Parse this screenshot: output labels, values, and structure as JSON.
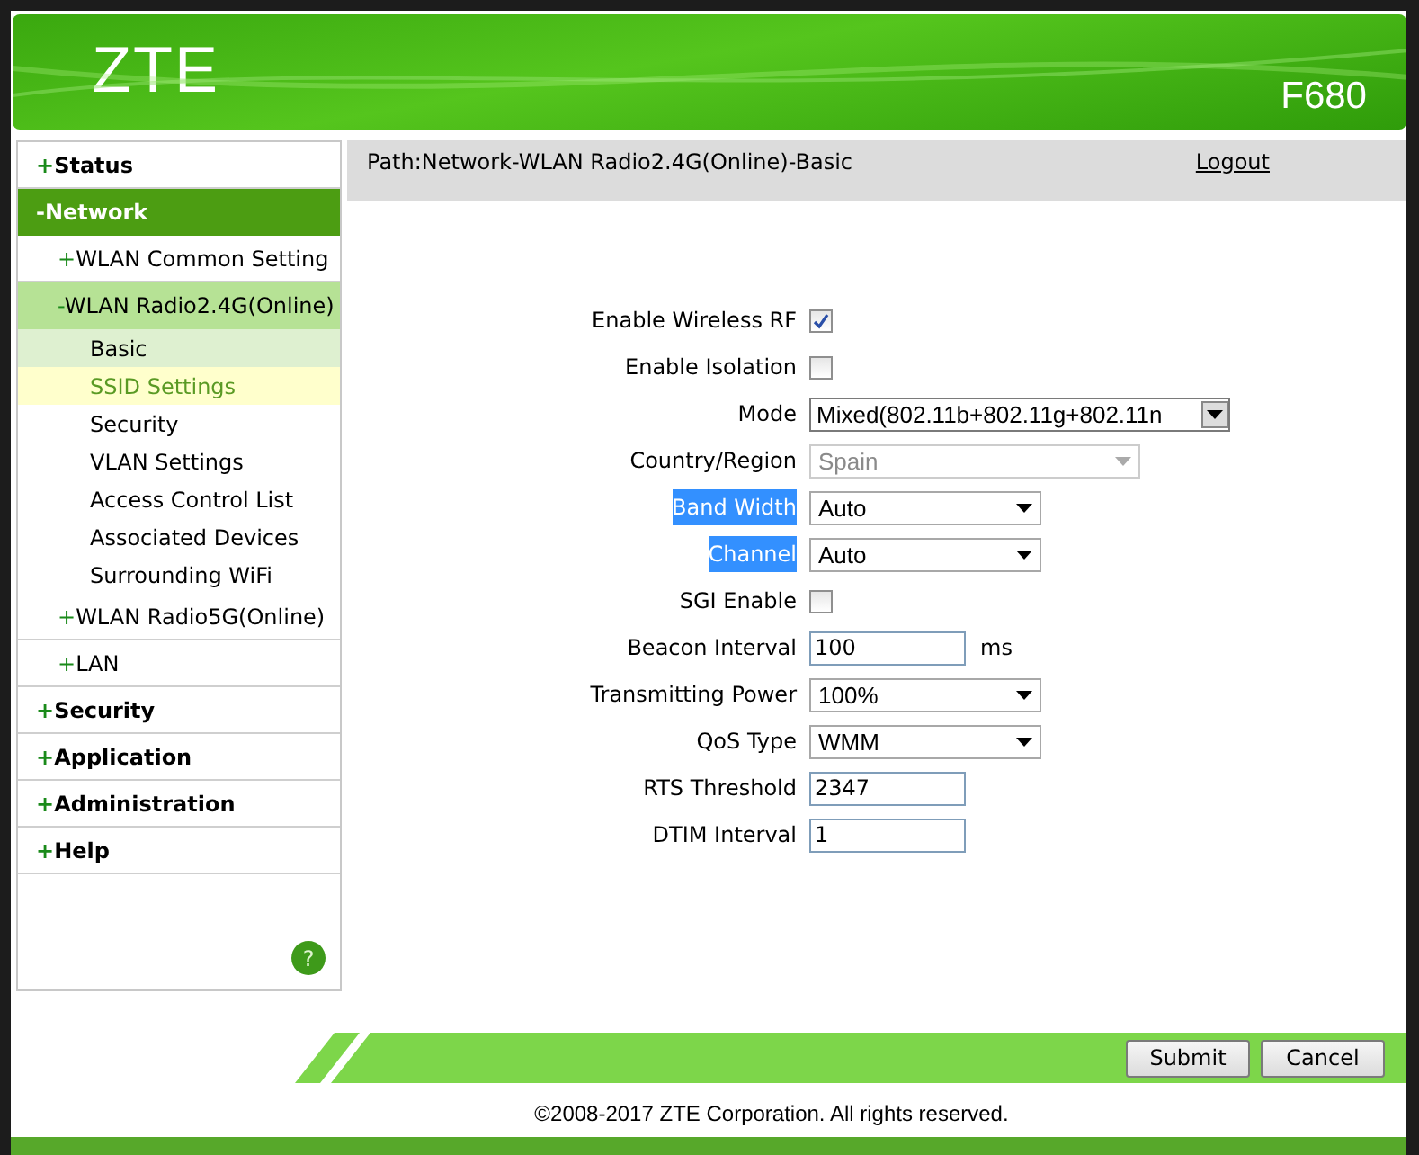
{
  "header": {
    "brand": "ZTE",
    "model": "F680"
  },
  "sidebar": {
    "items": [
      {
        "sign": "+",
        "label": "Status",
        "selected": false
      },
      {
        "sign": "-",
        "label": "Network",
        "selected": true,
        "children": [
          {
            "sign": "+",
            "label": "WLAN Common Setting",
            "selected": false
          },
          {
            "sign": "-",
            "label": "WLAN Radio2.4G(Online)",
            "selected": true,
            "children": [
              {
                "label": "Basic",
                "selected": true,
                "hovered": false
              },
              {
                "label": "SSID Settings",
                "selected": false,
                "hovered": true
              },
              {
                "label": "Security",
                "selected": false,
                "hovered": false
              },
              {
                "label": "VLAN Settings",
                "selected": false,
                "hovered": false
              },
              {
                "label": "Access Control List",
                "selected": false,
                "hovered": false
              },
              {
                "label": "Associated Devices",
                "selected": false,
                "hovered": false
              },
              {
                "label": "Surrounding WiFi",
                "selected": false,
                "hovered": false
              }
            ]
          },
          {
            "sign": "+",
            "label": "WLAN Radio5G(Online)",
            "selected": false
          },
          {
            "sign": "+",
            "label": "LAN",
            "selected": false
          }
        ]
      },
      {
        "sign": "+",
        "label": "Security",
        "selected": false
      },
      {
        "sign": "+",
        "label": "Application",
        "selected": false
      },
      {
        "sign": "+",
        "label": "Administration",
        "selected": false
      },
      {
        "sign": "+",
        "label": "Help",
        "selected": false
      }
    ],
    "help_mark": "?"
  },
  "path": "Path:Network-WLAN Radio2.4G(Online)-Basic",
  "logout": "Logout",
  "fields": [
    {
      "kind": "checkbox",
      "label": "Enable Wireless RF",
      "checked": true,
      "highlighted": false
    },
    {
      "kind": "checkbox",
      "label": "Enable Isolation",
      "checked": false,
      "highlighted": false
    },
    {
      "kind": "combo",
      "label": "Mode",
      "value": "Mixed(802.11b+802.11g+802.11n",
      "highlighted": false
    },
    {
      "kind": "select",
      "label": "Country/Region",
      "value": "Spain",
      "highlighted": false,
      "disabled": true
    },
    {
      "kind": "select",
      "label": "Band Width",
      "value": "Auto",
      "highlighted": true
    },
    {
      "kind": "select",
      "label": "Channel",
      "value": "Auto",
      "highlighted": true
    },
    {
      "kind": "checkbox",
      "label": "SGI Enable",
      "checked": false,
      "highlighted": false
    },
    {
      "kind": "input",
      "label": "Beacon Interval",
      "value": "100",
      "unit": "ms",
      "highlighted": false
    },
    {
      "kind": "select",
      "label": "Transmitting Power",
      "value": "100%",
      "highlighted": false
    },
    {
      "kind": "select",
      "label": "QoS Type",
      "value": "WMM",
      "highlighted": false
    },
    {
      "kind": "input",
      "label": "RTS Threshold",
      "value": "2347",
      "highlighted": false
    },
    {
      "kind": "input",
      "label": "DTIM Interval",
      "value": "1",
      "highlighted": false
    }
  ],
  "buttons": [
    "Submit",
    "Cancel"
  ],
  "copyright": "©2008-2017 ZTE Corporation. All rights reserved."
}
